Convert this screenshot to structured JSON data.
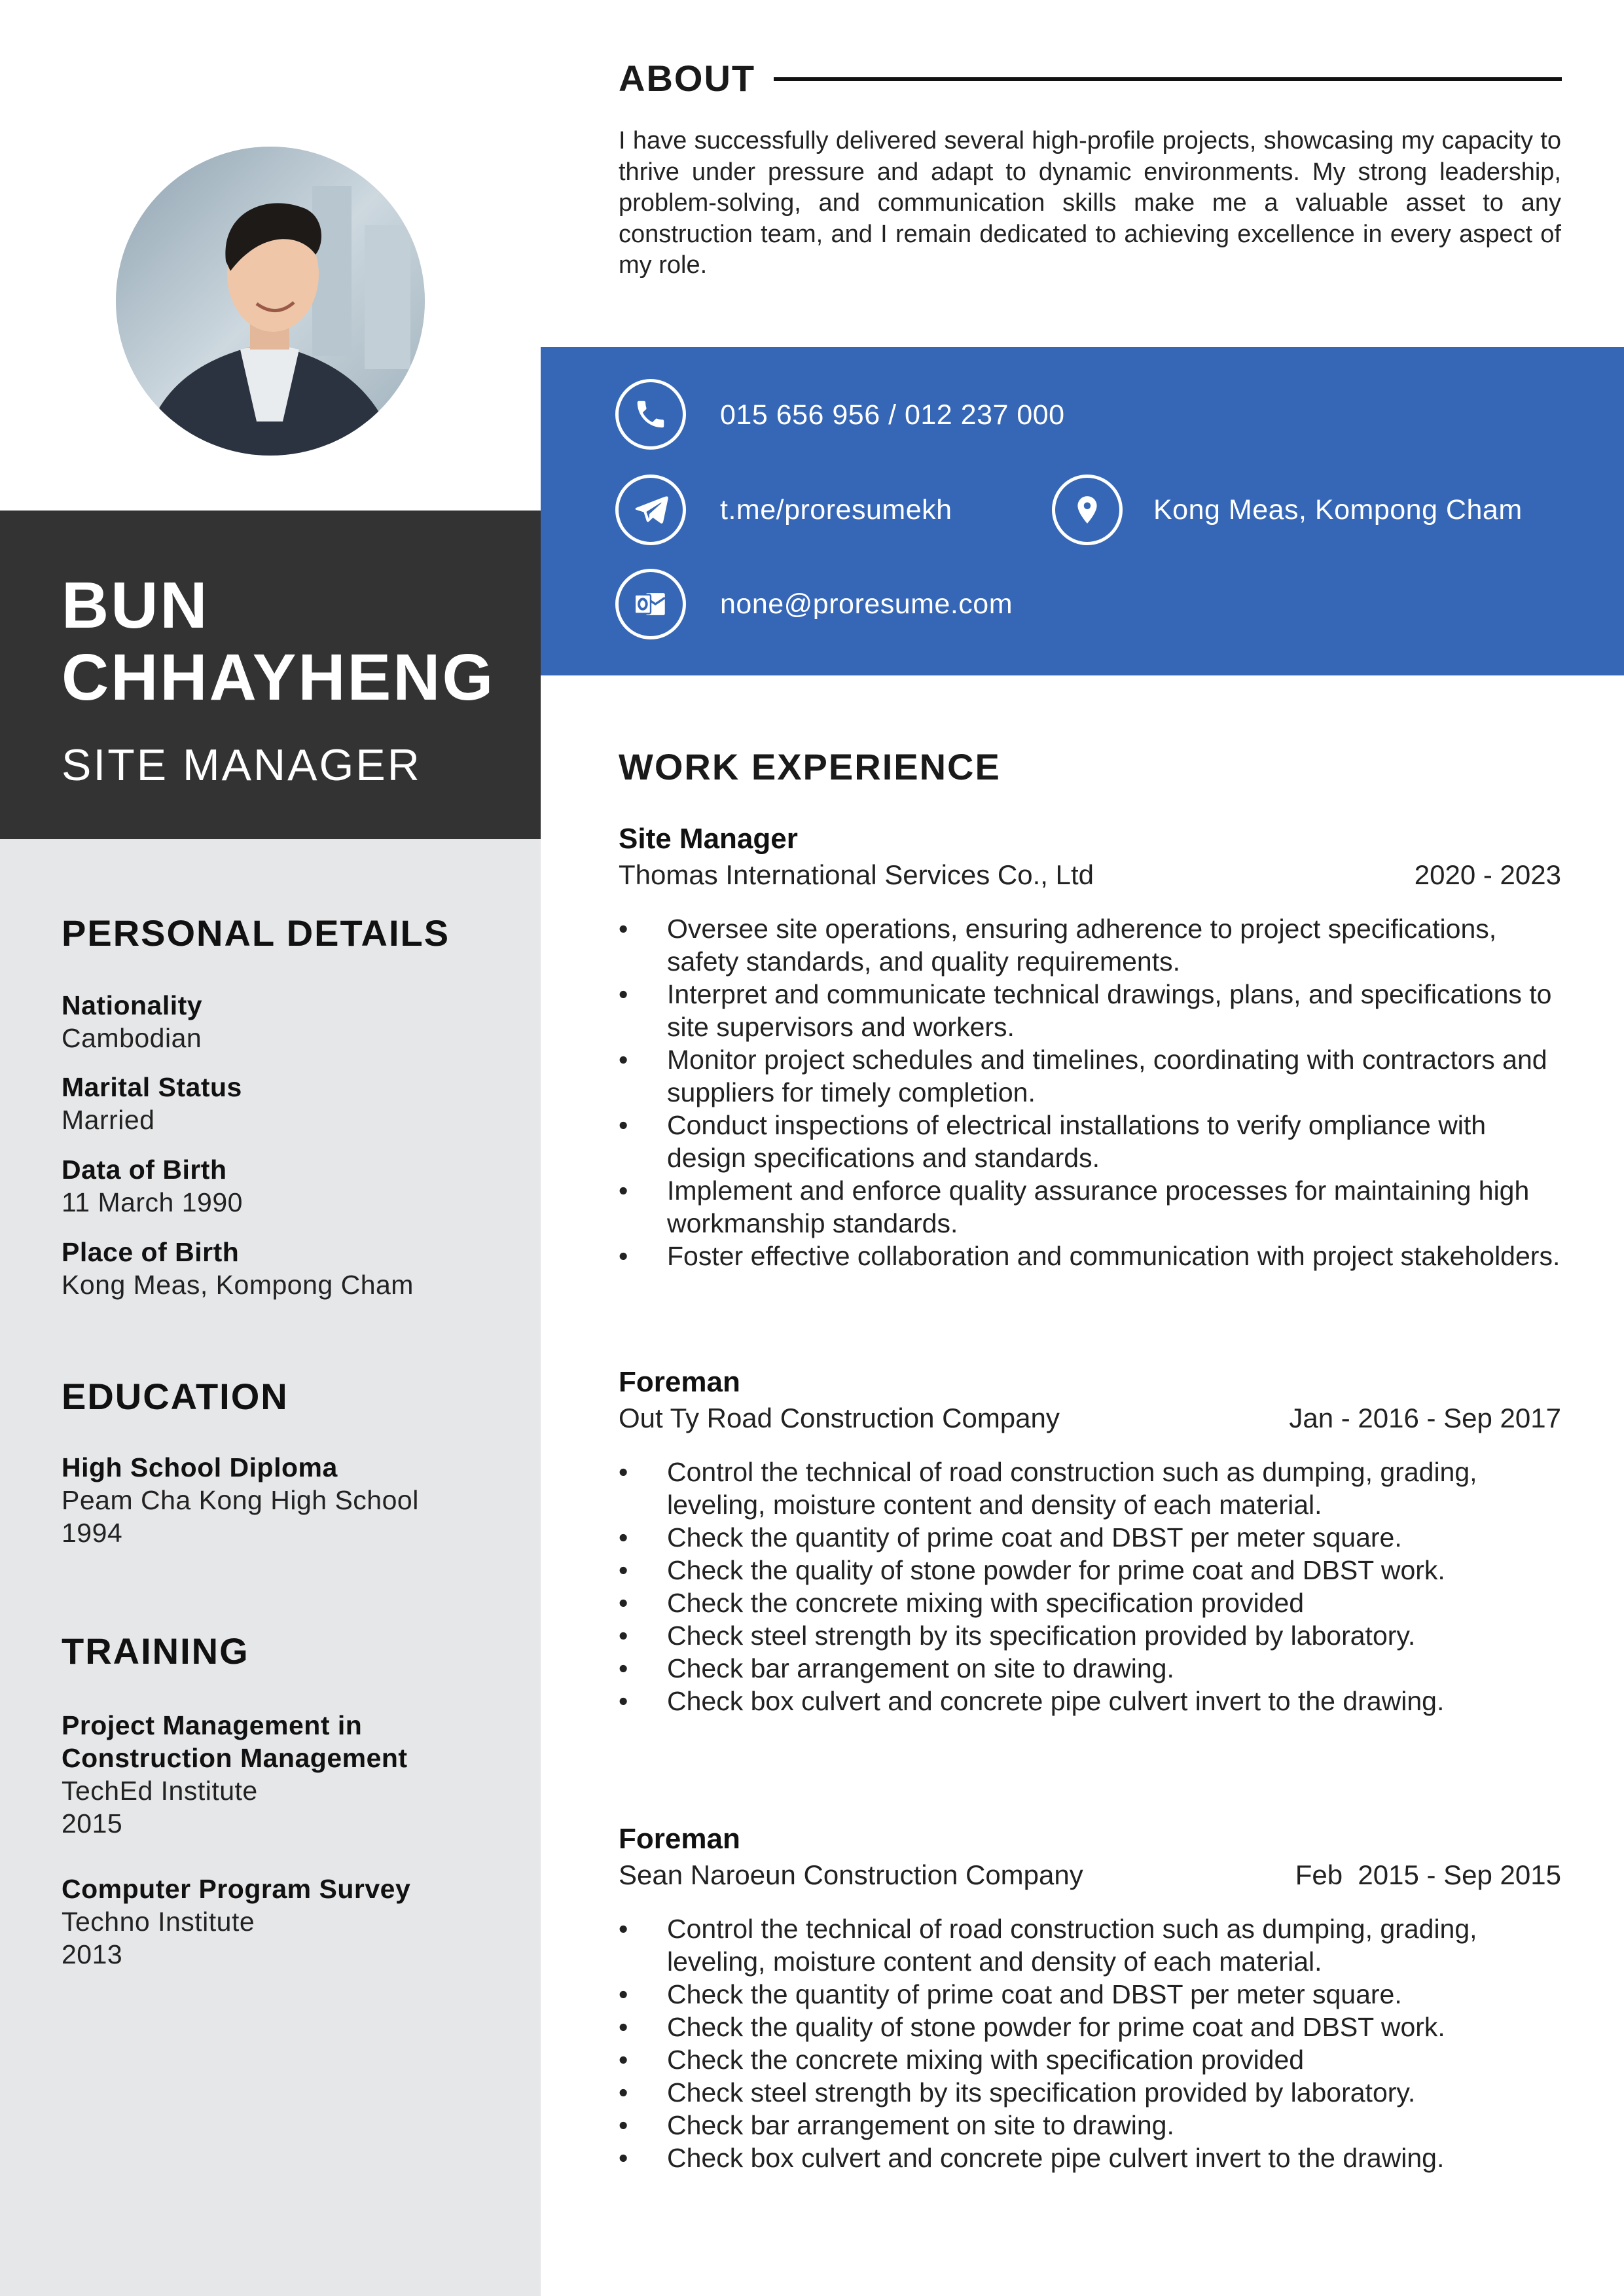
{
  "profile": {
    "first_name": "BUN",
    "last_name": "CHHAYHENG",
    "title": "SITE MANAGER"
  },
  "about": {
    "heading": "ABOUT",
    "text": "I have successfully delivered several high-profile projects, showcasing my capacity to thrive under pressure and adapt to dynamic environments. My strong leadership, problem-solving, and communication skills make me a valuable asset to any construction team, and I remain dedicated to achieving excellence in every aspect of my role."
  },
  "contact": {
    "phone": "015 656 956 / 012 237 000",
    "telegram": "t.me/proresumekh",
    "location": "Kong Meas, Kompong Cham",
    "email": "none@proresume.com",
    "icons": [
      "phone-icon",
      "telegram-icon",
      "location-pin-icon",
      "outlook-icon"
    ]
  },
  "personal": {
    "heading": "PERSONAL DETAILS",
    "items": [
      {
        "label": "Nationality",
        "value": "Cambodian"
      },
      {
        "label": "Marital Status",
        "value": "Married"
      },
      {
        "label": "Data of Birth",
        "value": "11 March 1990"
      },
      {
        "label": "Place of Birth",
        "value": "Kong Meas, Kompong Cham"
      }
    ]
  },
  "education": {
    "heading": "EDUCATION",
    "items": [
      {
        "degree": "High School Diploma",
        "school": "Peam Cha Kong High School",
        "year": "1994"
      }
    ]
  },
  "training": {
    "heading": "TRAINING",
    "items": [
      {
        "title_line1": "Project Management in",
        "title_line2": "Construction Management",
        "institute": "TechEd Institute",
        "year": "2015"
      },
      {
        "title_line1": "Computer Program Survey",
        "institute": "Techno Institute",
        "year": "2013"
      }
    ]
  },
  "work": {
    "heading": "WORK EXPERIENCE",
    "jobs": [
      {
        "title": "Site Manager",
        "company": "Thomas International Services Co., Ltd",
        "dates": "2020 - 2023",
        "duties": [
          "Oversee site operations, ensuring adherence to project specifications, safety standards, and quality requirements.",
          "Interpret and communicate technical drawings, plans, and specifications to site supervisors and workers.",
          "Monitor project schedules and timelines, coordinating with contractors and suppliers for timely completion.",
          "Conduct inspections of electrical installations to verify ompliance with design specifications and standards.",
          "Implement and enforce quality assurance processes for maintaining high workmanship standards.",
          "Foster effective collaboration and communication with project stakeholders."
        ]
      },
      {
        "title": "Foreman",
        "company": "Out Ty Road Construction Company",
        "dates": "Jan - 2016 - Sep 2017",
        "duties": [
          "Control the technical of road construction such as dumping, grading, leveling, moisture content and density of each material.",
          "Check the quantity of prime coat and DBST per meter square.",
          "Check the quality of stone powder for prime coat and DBST work.",
          "Check the concrete mixing with specification provided",
          "Check steel strength by its specification provided by laboratory.",
          "Check bar arrangement on site to drawing.",
          "Check box culvert and concrete pipe culvert invert to the drawing."
        ]
      },
      {
        "title": "Foreman",
        "company": "Sean Naroeun Construction Company",
        "dates": "Feb  2015 - Sep 2015",
        "duties": [
          "Control the technical of road construction such as dumping, grading, leveling, moisture content and density of each material.",
          "Check the quantity of prime coat and DBST per meter square.",
          "Check the quality of stone powder for prime coat and DBST work.",
          "Check the concrete mixing with specification provided",
          "Check steel strength by its specification provided by laboratory.",
          "Check bar arrangement on site to drawing.",
          "Check box culvert and concrete pipe culvert invert to the drawing."
        ]
      }
    ]
  },
  "colors": {
    "accent_blue": "#3667b7",
    "dark_block": "#333333",
    "sidebar_grey": "#e6e7e9"
  }
}
